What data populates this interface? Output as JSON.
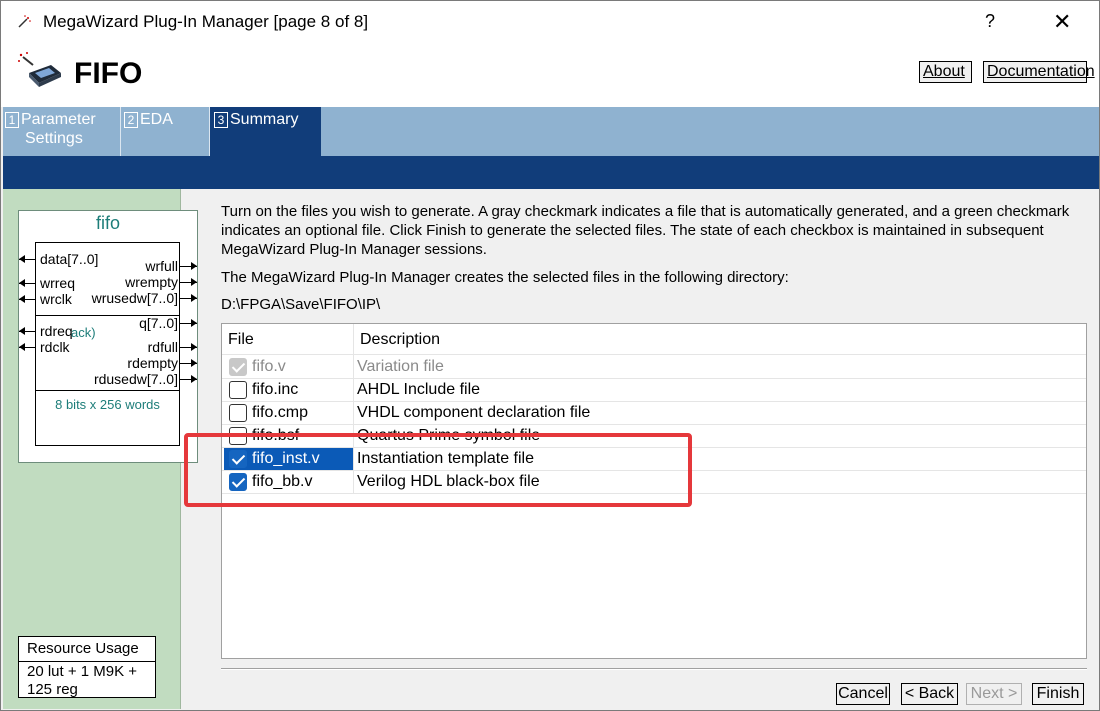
{
  "window": {
    "title": "MegaWizard Plug-In Manager [page 8 of 8]",
    "help_glyph": "?",
    "close_glyph": "✕"
  },
  "header": {
    "title": "FIFO",
    "about_label": "About",
    "documentation_label": "Documentation"
  },
  "tabs": [
    {
      "num": "1",
      "label_line1": "Parameter",
      "label_line2": "Settings"
    },
    {
      "num": "2",
      "label_line1": "EDA",
      "label_line2": ""
    },
    {
      "num": "3",
      "label_line1": "Summary",
      "label_line2": ""
    }
  ],
  "symbol": {
    "name": "fifo",
    "left_ports": [
      "data[7..0]",
      "wrreq",
      "wrclk",
      "rdreq",
      "rdclk"
    ],
    "right_ports": [
      "wrfull",
      "wrempty",
      "wrusedw[7..0]",
      "q[7..0]",
      "rdfull",
      "rdempty",
      "rdusedw[7..0]"
    ],
    "ack_note": "ack)",
    "size_note": "8 bits x 256 words"
  },
  "resource": {
    "title": "Resource Usage",
    "line1": "20 lut + 1 M9K +",
    "line2": "125 reg"
  },
  "content": {
    "intro": "Turn on the files you wish to generate. A gray checkmark indicates a file that is automatically generated, and a green checkmark indicates an optional file. Click Finish to generate the selected files. The state of each checkbox is maintained in subsequent MegaWizard Plug-In Manager sessions.",
    "dir_label": "The MegaWizard Plug-In Manager creates the selected files in the following directory:",
    "dir_path": "D:\\FPGA\\Save\\FIFO\\IP\\"
  },
  "file_table": {
    "headers": [
      "File",
      "Description"
    ],
    "rows": [
      {
        "file": "fifo.v",
        "description": "Variation file",
        "state": "auto"
      },
      {
        "file": "fifo.inc",
        "description": "AHDL Include file",
        "state": "unchecked"
      },
      {
        "file": "fifo.cmp",
        "description": "VHDL component declaration file",
        "state": "unchecked"
      },
      {
        "file": "fifo.bsf",
        "description": "Quartus Prime symbol file",
        "state": "unchecked"
      },
      {
        "file": "fifo_inst.v",
        "description": "Instantiation template file",
        "state": "checked"
      },
      {
        "file": "fifo_bb.v",
        "description": "Verilog HDL black-box file",
        "state": "checked"
      }
    ]
  },
  "buttons": {
    "cancel": "Cancel",
    "back": "< Back",
    "next": "Next >",
    "finish": "Finish"
  },
  "colors": {
    "tab_bar": "#8fb2d0",
    "active_tab": "#113d7a",
    "left_panel": "#c1dcc0",
    "highlight_box": "#e5383b",
    "checkbox_checked": "#1565c0",
    "selected_row": "#0b5ab7"
  }
}
